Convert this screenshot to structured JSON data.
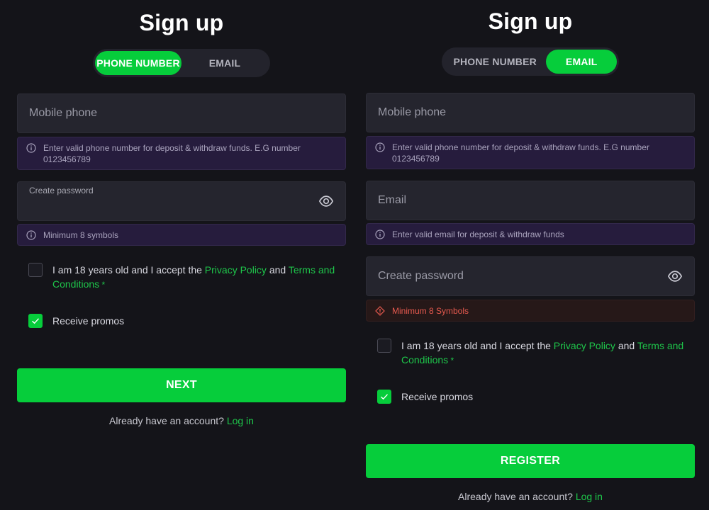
{
  "phone_form": {
    "title": "Sign up",
    "tabs": [
      {
        "label": "PHONE NUMBER",
        "active": true
      },
      {
        "label": "EMAIL",
        "active": false
      }
    ],
    "mobile_placeholder": "Mobile phone",
    "mobile_hint": "Enter valid phone number for deposit & withdraw funds. E.G number 0123456789",
    "password_label": "Create password",
    "password_hint": "Minimum 8 symbols",
    "terms": {
      "prefix": "I am 18 years old and I accept the ",
      "privacy_link": "Privacy Policy",
      "middle": " and ",
      "terms_link": "Terms and Conditions",
      "required_mark": " *",
      "checked": false
    },
    "promos": {
      "label": "Receive promos",
      "checked": true
    },
    "submit_label": "NEXT",
    "footer": {
      "text": "Already have an account? ",
      "link": "Log in"
    }
  },
  "email_form": {
    "title": "Sign up",
    "tabs": [
      {
        "label": "PHONE NUMBER",
        "active": false
      },
      {
        "label": "EMAIL",
        "active": true
      }
    ],
    "mobile_placeholder": "Mobile phone",
    "mobile_hint": "Enter valid phone number for deposit & withdraw funds. E.G number 0123456789",
    "email_placeholder": "Email",
    "email_hint": "Enter valid email for deposit & withdraw funds",
    "password_placeholder": "Create password",
    "password_error": "Minimum 8 Symbols",
    "terms": {
      "prefix": "I am 18 years old and I accept the ",
      "privacy_link": "Privacy Policy",
      "middle": " and ",
      "terms_link": "Terms and Conditions",
      "required_mark": " *",
      "checked": false
    },
    "promos": {
      "label": "Receive promos",
      "checked": true
    },
    "submit_label": "REGISTER",
    "footer": {
      "text": "Already have an account? ",
      "link": "Log in"
    }
  },
  "colors": {
    "background": "#141419",
    "accent_green": "#06cd3b",
    "link_green": "#1ec54a",
    "field_bg": "#25252e",
    "hint_bg": "#261c3d",
    "error_bg": "#261818",
    "error_text": "#e85a4f"
  },
  "icons": [
    "info-icon",
    "eye-icon",
    "warning-icon",
    "check-icon"
  ]
}
